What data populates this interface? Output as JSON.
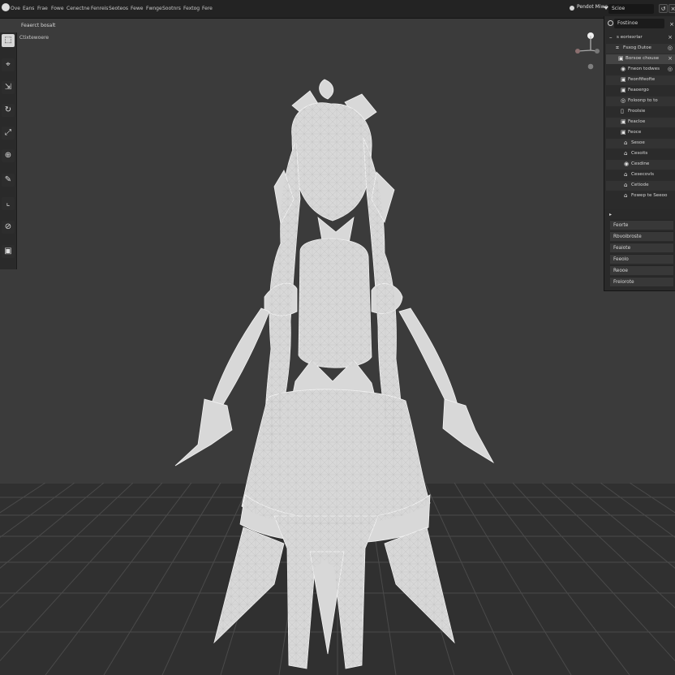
{
  "top_menu": [
    "Ove",
    "Eans",
    "Frae",
    "Fowe",
    "Cenectne",
    "Fenreis",
    "Seoteos",
    "Fewe",
    "Fwnge",
    "Sootnrs",
    "Fextog",
    "Fere"
  ],
  "topbar": {
    "render_mode": "Pendot Miwe",
    "scene": "Scioe",
    "button_labels": [
      "↺",
      "×"
    ]
  },
  "viewport": {
    "editor_title": "Feaerct bosalt",
    "mode_label": "Ctixtewoere"
  },
  "outliner": {
    "search": "Fostinoe",
    "items": [
      {
        "label": "s eoriexrlar",
        "icon": "tree-icon"
      },
      {
        "label": "Fsxog Dutoe",
        "icon": "mesh-icon"
      },
      {
        "label": "Borsoe chouse",
        "icon": "collection-icon"
      },
      {
        "label": "Fneon todwes",
        "icon": "object-icon"
      },
      {
        "label": "Feonfifeofte",
        "icon": "object-icon"
      },
      {
        "label": "Feaoergo",
        "icon": "object-icon"
      },
      {
        "label": "Foloonp to to",
        "icon": "object-icon"
      },
      {
        "label": "Froolsie",
        "icon": "object-icon"
      },
      {
        "label": "Feacloe",
        "icon": "object-icon"
      },
      {
        "label": "Feoce",
        "icon": "object-icon"
      },
      {
        "label": "Sesoe",
        "icon": "object-icon"
      },
      {
        "label": "Cesoits",
        "icon": "object-icon"
      },
      {
        "label": "Cesdine",
        "icon": "object-icon"
      },
      {
        "label": "Cesecovls",
        "icon": "object-icon"
      },
      {
        "label": "Cetiode",
        "icon": "object-icon"
      },
      {
        "label": "Fowep te Seeoo",
        "icon": "object-icon"
      }
    ]
  },
  "properties": {
    "items": [
      "Feorte",
      "Rbvoibroste",
      "Feaiote",
      "Feeolo",
      "Reooe",
      "Freiorote"
    ]
  }
}
